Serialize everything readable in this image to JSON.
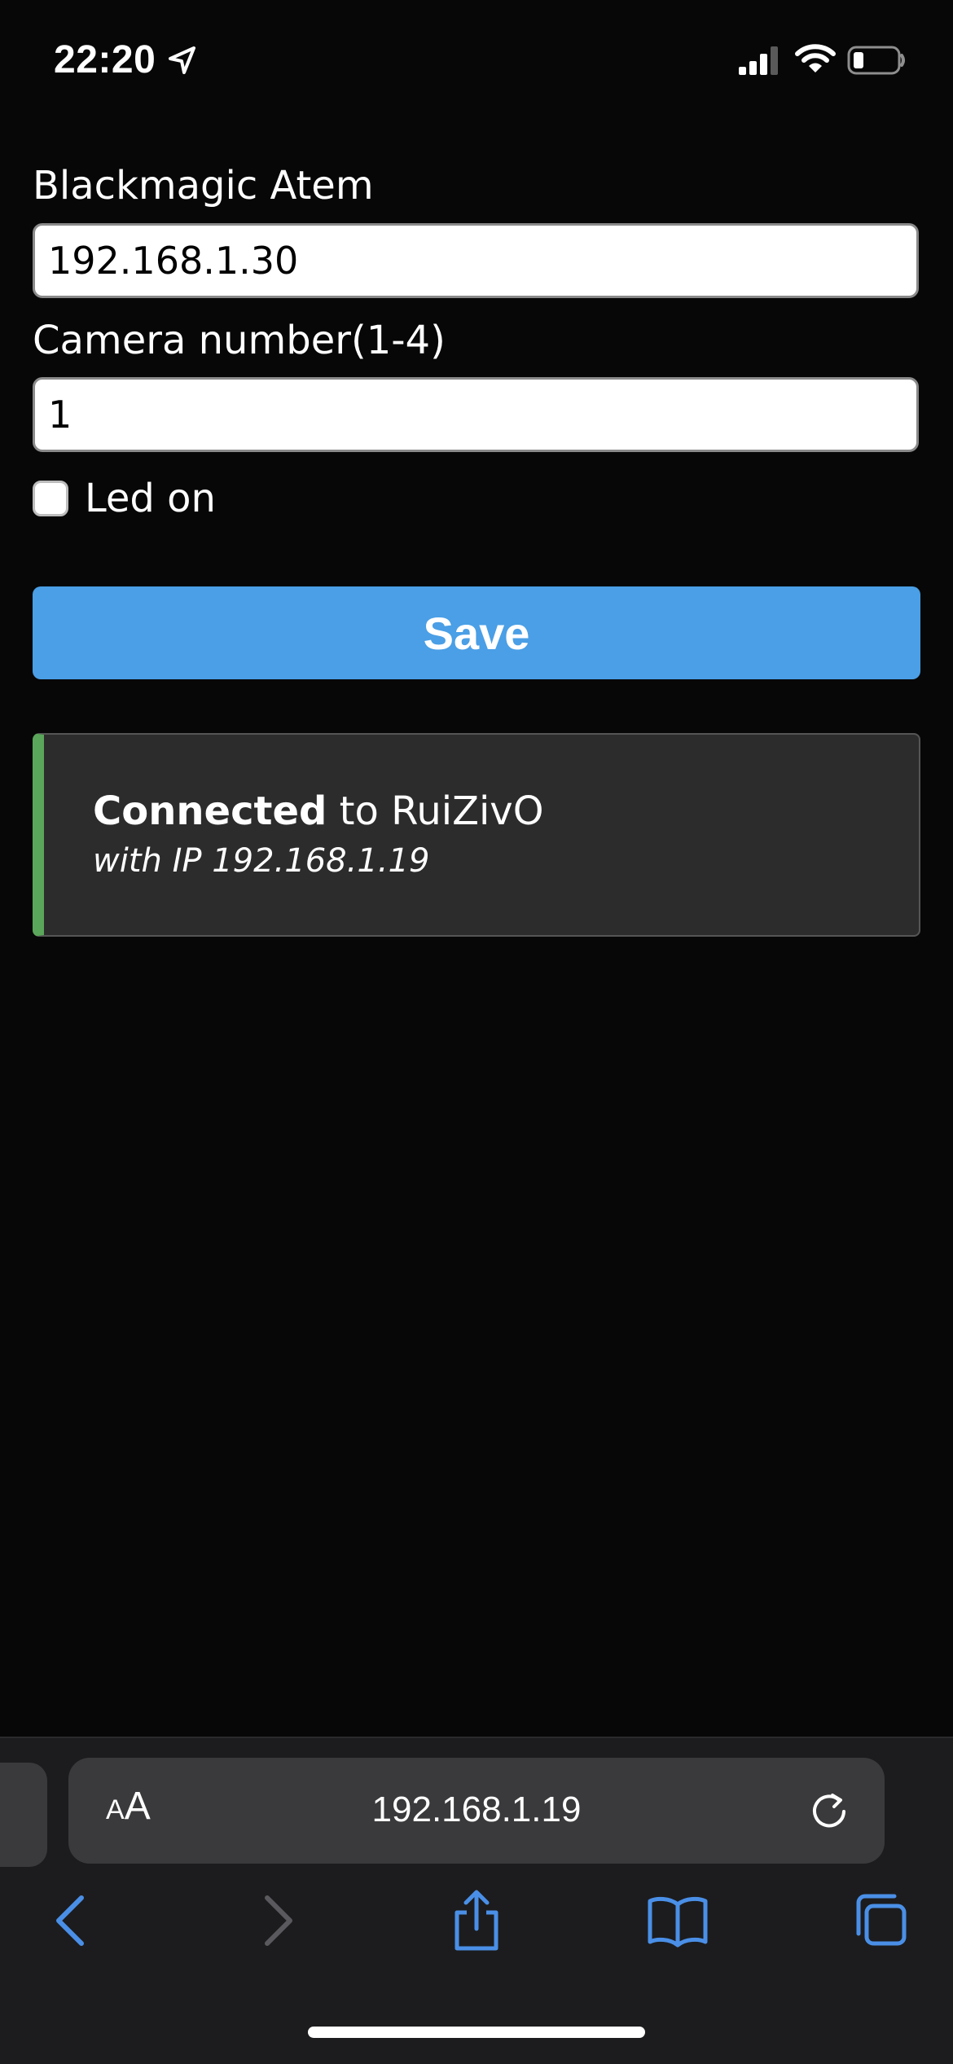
{
  "status_bar": {
    "time": "22:20",
    "icons": [
      "location-arrow-icon",
      "cellular-signal-icon",
      "wifi-icon",
      "battery-low-icon"
    ]
  },
  "form": {
    "atem_label": "Blackmagic Atem",
    "atem_value": "192.168.1.30",
    "camera_label": "Camera number(1-4)",
    "camera_value": "1",
    "led_label": "Led on",
    "led_checked": false,
    "save_label": "Save"
  },
  "status": {
    "connected_word": "Connected",
    "to_text": " to RuiZivO",
    "ip_text": "with IP 192.168.1.19",
    "accent_color": "#5aa65a"
  },
  "browser": {
    "text_size_small": "A",
    "text_size_big": "A",
    "url": "192.168.1.19",
    "toolbar_icons": [
      "back-icon",
      "forward-icon",
      "share-icon",
      "bookmarks-icon",
      "tabs-icon"
    ]
  },
  "colors": {
    "background": "#070707",
    "save_button": "#4a9fe6",
    "browser_accent": "#4a8fe7"
  }
}
